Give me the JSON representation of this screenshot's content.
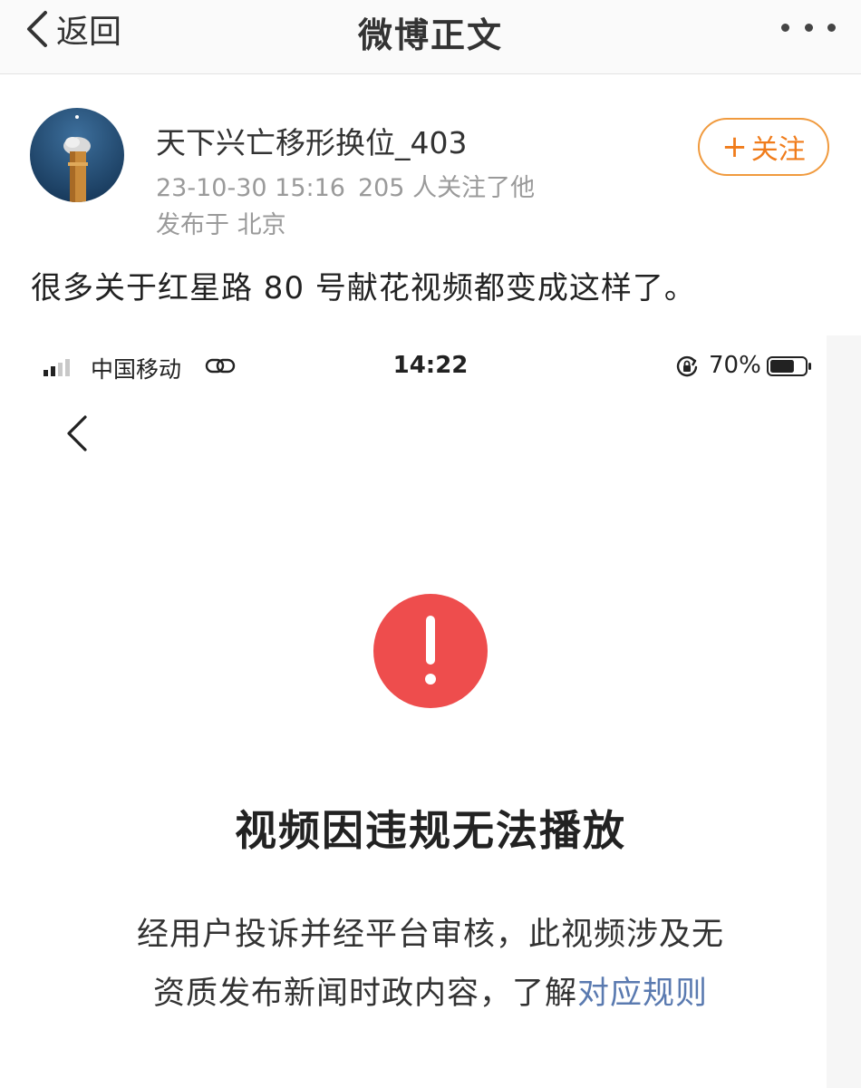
{
  "nav": {
    "back_label": "返回",
    "title": "微博正文"
  },
  "author": {
    "name": "天下兴亡移形换位_403",
    "time": "23-10-30 15:16",
    "followers": "205 人关注了他",
    "location": "发布于 北京",
    "follow_plus": "+",
    "follow_label": "关注"
  },
  "post": {
    "text": "很多关于红星路 80 号献花视频都变成这样了。"
  },
  "embed": {
    "status_bar": {
      "carrier": "中国移动",
      "time": "14:22",
      "battery": "70%",
      "battery_level": 0.7
    },
    "error": {
      "title": "视频因违规无法播放",
      "line1": "经用户投诉并经平台审核，此视频涉及无",
      "line2_prefix": "资质发布新闻时政内容，了解",
      "line2_link": "对应规则"
    }
  },
  "colors": {
    "accent_orange": "#f07c1b",
    "warning_red": "#ee4d4d",
    "link_blue": "#5a7ab0",
    "meta_gray": "#9a9a9a"
  },
  "icons": [
    "chevron-left-icon",
    "more-dots-icon",
    "signal-icon",
    "link-icon",
    "rotation-lock-icon",
    "battery-icon",
    "exclamation-icon"
  ]
}
